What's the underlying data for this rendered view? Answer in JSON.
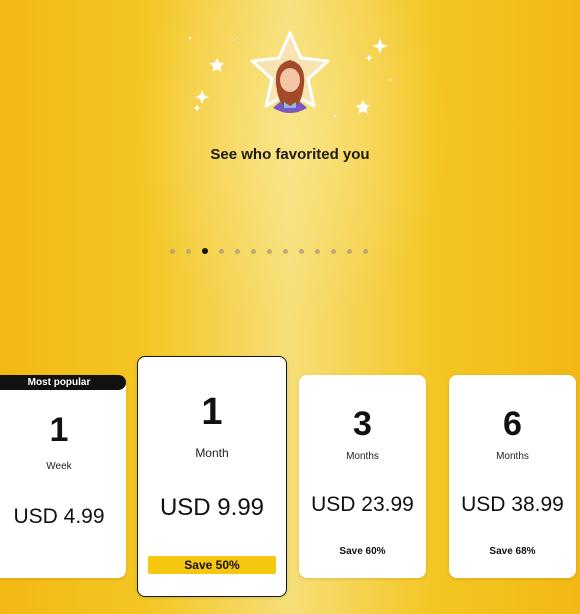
{
  "headline": "See who favorited you",
  "carousel": {
    "total_dots": 13,
    "active_index": 2
  },
  "plans": {
    "week": {
      "badge": "Most popular",
      "count": "1",
      "unit": "Week",
      "price": "USD 4.99"
    },
    "month": {
      "count": "1",
      "unit": "Month",
      "price": "USD 9.99",
      "save": "Save 50%"
    },
    "three_months": {
      "count": "3",
      "unit": "Months",
      "price": "USD 23.99",
      "save": "Save 60%"
    },
    "six_months": {
      "count": "6",
      "unit": "Months",
      "price": "USD 38.99",
      "save": "Save 68%"
    }
  },
  "colors": {
    "background": "#f4c623",
    "accent": "#f7c60f",
    "selected_border": "#1a1a1a"
  }
}
